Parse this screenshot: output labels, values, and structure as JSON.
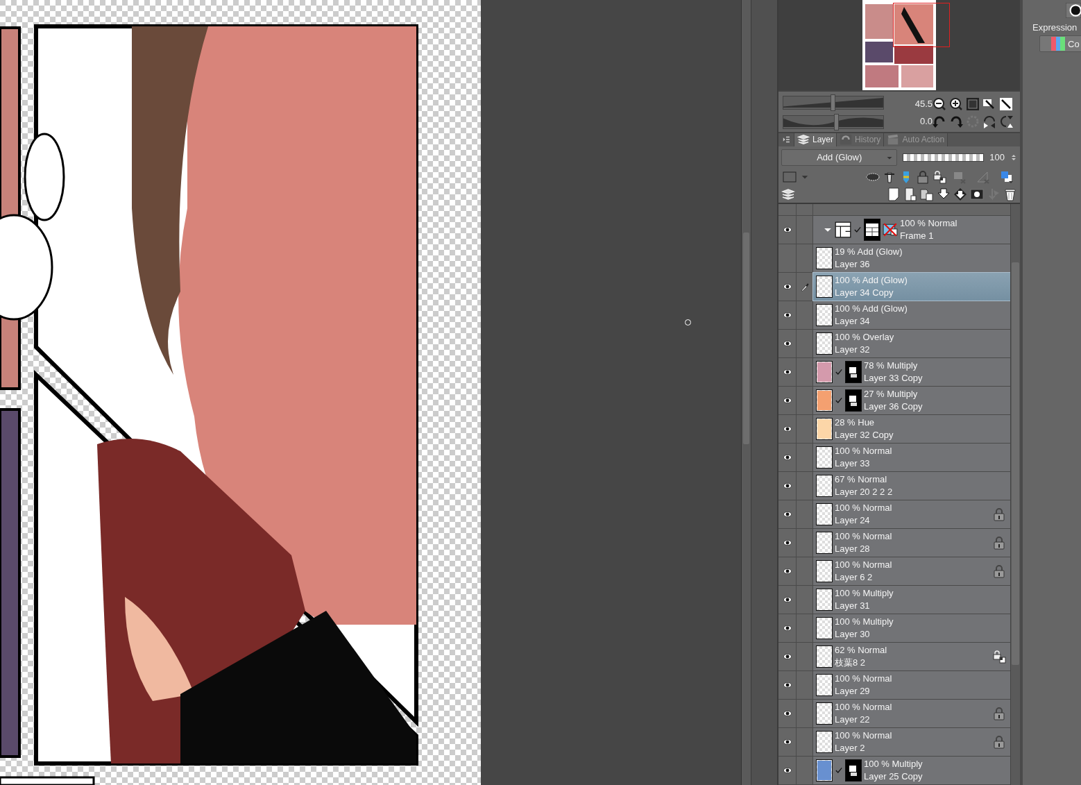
{
  "navigator": {
    "zoom": "45.5",
    "zoom_slider": {
      "level": 0.49
    },
    "rotation": "0.0",
    "rotation_slider": {
      "level": 0.53
    }
  },
  "tabs": [
    {
      "label": "Layer",
      "selected": true
    },
    {
      "label": "History",
      "selected": false
    },
    {
      "label": "Auto Action",
      "selected": false
    }
  ],
  "blend_mode": "Add (Glow)",
  "opacity": {
    "level": 1.0,
    "reading": "100"
  },
  "layers": [
    {
      "kind": "frame",
      "mode": "100 % Normal",
      "name": "Frame 1",
      "visible": true,
      "editing": false,
      "selected": false,
      "mask": true,
      "locked": false,
      "alpha_locked": false
    },
    {
      "kind": "layer",
      "mode": "19 % Add (Glow)",
      "name": "Layer 36",
      "visible": false,
      "editing": false,
      "selected": false,
      "mask": false,
      "locked": false,
      "alpha_locked": false
    },
    {
      "kind": "layer",
      "mode": "100 % Add (Glow)",
      "name": "Layer 34 Copy",
      "visible": true,
      "editing": true,
      "selected": true,
      "mask": false,
      "locked": false,
      "alpha_locked": false
    },
    {
      "kind": "layer",
      "mode": "100 % Add (Glow)",
      "name": "Layer 34",
      "visible": true,
      "editing": false,
      "selected": false,
      "mask": false,
      "locked": false,
      "alpha_locked": false
    },
    {
      "kind": "layer",
      "mode": "100 % Overlay",
      "name": "Layer 32",
      "visible": true,
      "editing": false,
      "selected": false,
      "mask": false,
      "locked": false,
      "alpha_locked": false
    },
    {
      "kind": "layer",
      "mode": "78 % Multiply",
      "name": "Layer 33 Copy",
      "visible": true,
      "editing": false,
      "selected": false,
      "mask": true,
      "locked": false,
      "alpha_locked": false,
      "color": "#d49aac"
    },
    {
      "kind": "layer",
      "mode": "27 % Multiply",
      "name": "Layer 36 Copy",
      "visible": true,
      "editing": false,
      "selected": false,
      "mask": true,
      "locked": false,
      "alpha_locked": false,
      "color": "#f4a070"
    },
    {
      "kind": "layer",
      "mode": "28 % Hue",
      "name": "Layer 32 Copy",
      "visible": true,
      "editing": false,
      "selected": false,
      "mask": false,
      "locked": false,
      "alpha_locked": false,
      "color": "#fcd6a8"
    },
    {
      "kind": "layer",
      "mode": "100 % Normal",
      "name": "Layer 33",
      "visible": true,
      "editing": false,
      "selected": false,
      "mask": false,
      "locked": false,
      "alpha_locked": false
    },
    {
      "kind": "layer",
      "mode": "67 % Normal",
      "name": "Layer 20 2 2 2",
      "visible": true,
      "editing": false,
      "selected": false,
      "mask": false,
      "locked": false,
      "alpha_locked": false
    },
    {
      "kind": "layer",
      "mode": "100 % Normal",
      "name": "Layer 24",
      "visible": true,
      "editing": false,
      "selected": false,
      "mask": false,
      "locked": true,
      "alpha_locked": false
    },
    {
      "kind": "layer",
      "mode": "100 % Normal",
      "name": "Layer 28",
      "visible": true,
      "editing": false,
      "selected": false,
      "mask": false,
      "locked": true,
      "alpha_locked": false
    },
    {
      "kind": "layer",
      "mode": "100 % Normal",
      "name": "Layer 6 2",
      "visible": true,
      "editing": false,
      "selected": false,
      "mask": false,
      "locked": true,
      "alpha_locked": false
    },
    {
      "kind": "layer",
      "mode": "100 % Multiply",
      "name": "Layer 31",
      "visible": true,
      "editing": false,
      "selected": false,
      "mask": false,
      "locked": false,
      "alpha_locked": false
    },
    {
      "kind": "layer",
      "mode": "100 % Multiply",
      "name": "Layer 30",
      "visible": true,
      "editing": false,
      "selected": false,
      "mask": false,
      "locked": false,
      "alpha_locked": false
    },
    {
      "kind": "layer",
      "mode": "62 % Normal",
      "name": "枝葉8 2",
      "visible": true,
      "editing": false,
      "selected": false,
      "mask": false,
      "locked": false,
      "alpha_locked": true
    },
    {
      "kind": "layer",
      "mode": "100 % Normal",
      "name": "Layer 29",
      "visible": true,
      "editing": false,
      "selected": false,
      "mask": false,
      "locked": false,
      "alpha_locked": false
    },
    {
      "kind": "layer",
      "mode": "100 % Normal",
      "name": "Layer 22",
      "visible": true,
      "editing": false,
      "selected": false,
      "mask": false,
      "locked": true,
      "alpha_locked": false
    },
    {
      "kind": "layer",
      "mode": "100 % Normal",
      "name": "Layer 2",
      "visible": true,
      "editing": false,
      "selected": false,
      "mask": false,
      "locked": true,
      "alpha_locked": false
    },
    {
      "kind": "layer",
      "mode": "100 % Multiply",
      "name": "Layer 25 Copy",
      "visible": true,
      "editing": false,
      "selected": false,
      "mask": true,
      "locked": false,
      "alpha_locked": false,
      "color": "#6890d0"
    }
  ],
  "side_panel": {
    "title": "Expression",
    "button": "Co"
  }
}
